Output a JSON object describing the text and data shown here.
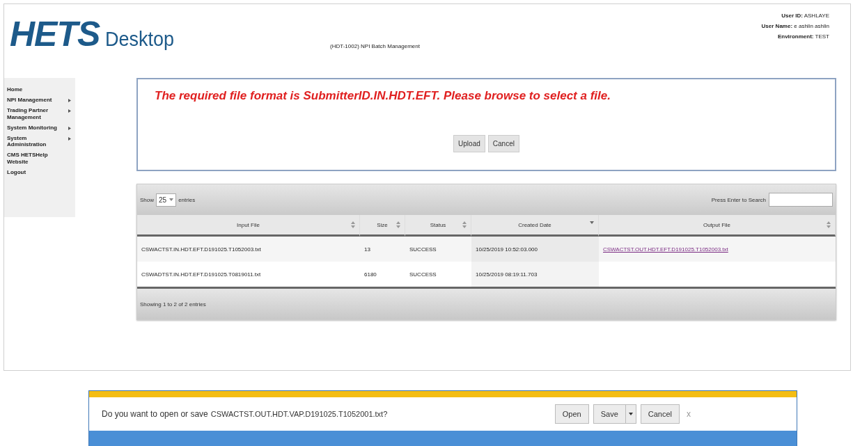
{
  "header": {
    "logo_main": "HETS",
    "logo_sub": "Desktop",
    "page_title": "(HDT-1002) NPI Batch Management",
    "user_info": [
      {
        "label": "User ID:",
        "value": "ASHLAYE"
      },
      {
        "label": "User Name:",
        "value": "e ashlin ashlin"
      },
      {
        "label": "Environment:",
        "value": "TEST"
      }
    ]
  },
  "sidebar": {
    "items": [
      {
        "label": "Home",
        "has_submenu": false
      },
      {
        "label": "NPI Management",
        "has_submenu": true
      },
      {
        "label": "Trading Partner Management",
        "has_submenu": true
      },
      {
        "label": "System Monitoring",
        "has_submenu": true
      },
      {
        "label": "System Administration",
        "has_submenu": true
      },
      {
        "label": "CMS HETSHelp Website",
        "has_submenu": false
      },
      {
        "label": "Logout",
        "has_submenu": false
      }
    ]
  },
  "upload": {
    "message": "The required file format is SubmitterID.IN.HDT.EFT. Please browse to select a file.",
    "buttons": [
      "Upload",
      "Cancel"
    ]
  },
  "table": {
    "show_label": "Show",
    "page_size": "25",
    "entries_label": "entries",
    "search_label": "Press Enter to Search",
    "columns": [
      {
        "label": "Input File",
        "kind": "sortable"
      },
      {
        "label": "Size",
        "kind": "sortable"
      },
      {
        "label": "Status",
        "kind": "sortable"
      },
      {
        "label": "Created Date",
        "kind": "sorted"
      },
      {
        "label": "Output File",
        "kind": "sortable"
      }
    ],
    "rows": [
      {
        "input_file": "CSWACTST.IN.HDT.EFT.D191025.T1052003.txt",
        "size": "13",
        "status": "SUCCESS",
        "created_date": "10/25/2019 10:52:03.000",
        "output_file": "CSWACTST.OUT.HDT.EFT.D191025.T1052003.txt"
      },
      {
        "input_file": "CSWADTST.IN.HDT.EFT.D191025.T0819011.txt",
        "size": "6180",
        "status": "SUCCESS",
        "created_date": "10/25/2019 08:19:11.703"
      }
    ],
    "info": "Showing 1 to 2 of 2 entries"
  },
  "download_bar": {
    "prompt": "Do you want to open or save",
    "file_name": "CSWACTST.OUT.HDT.VAP.D191025.T1052001.txt?",
    "open": "Open",
    "save": "Save",
    "cancel": "Cancel",
    "close": "x"
  }
}
